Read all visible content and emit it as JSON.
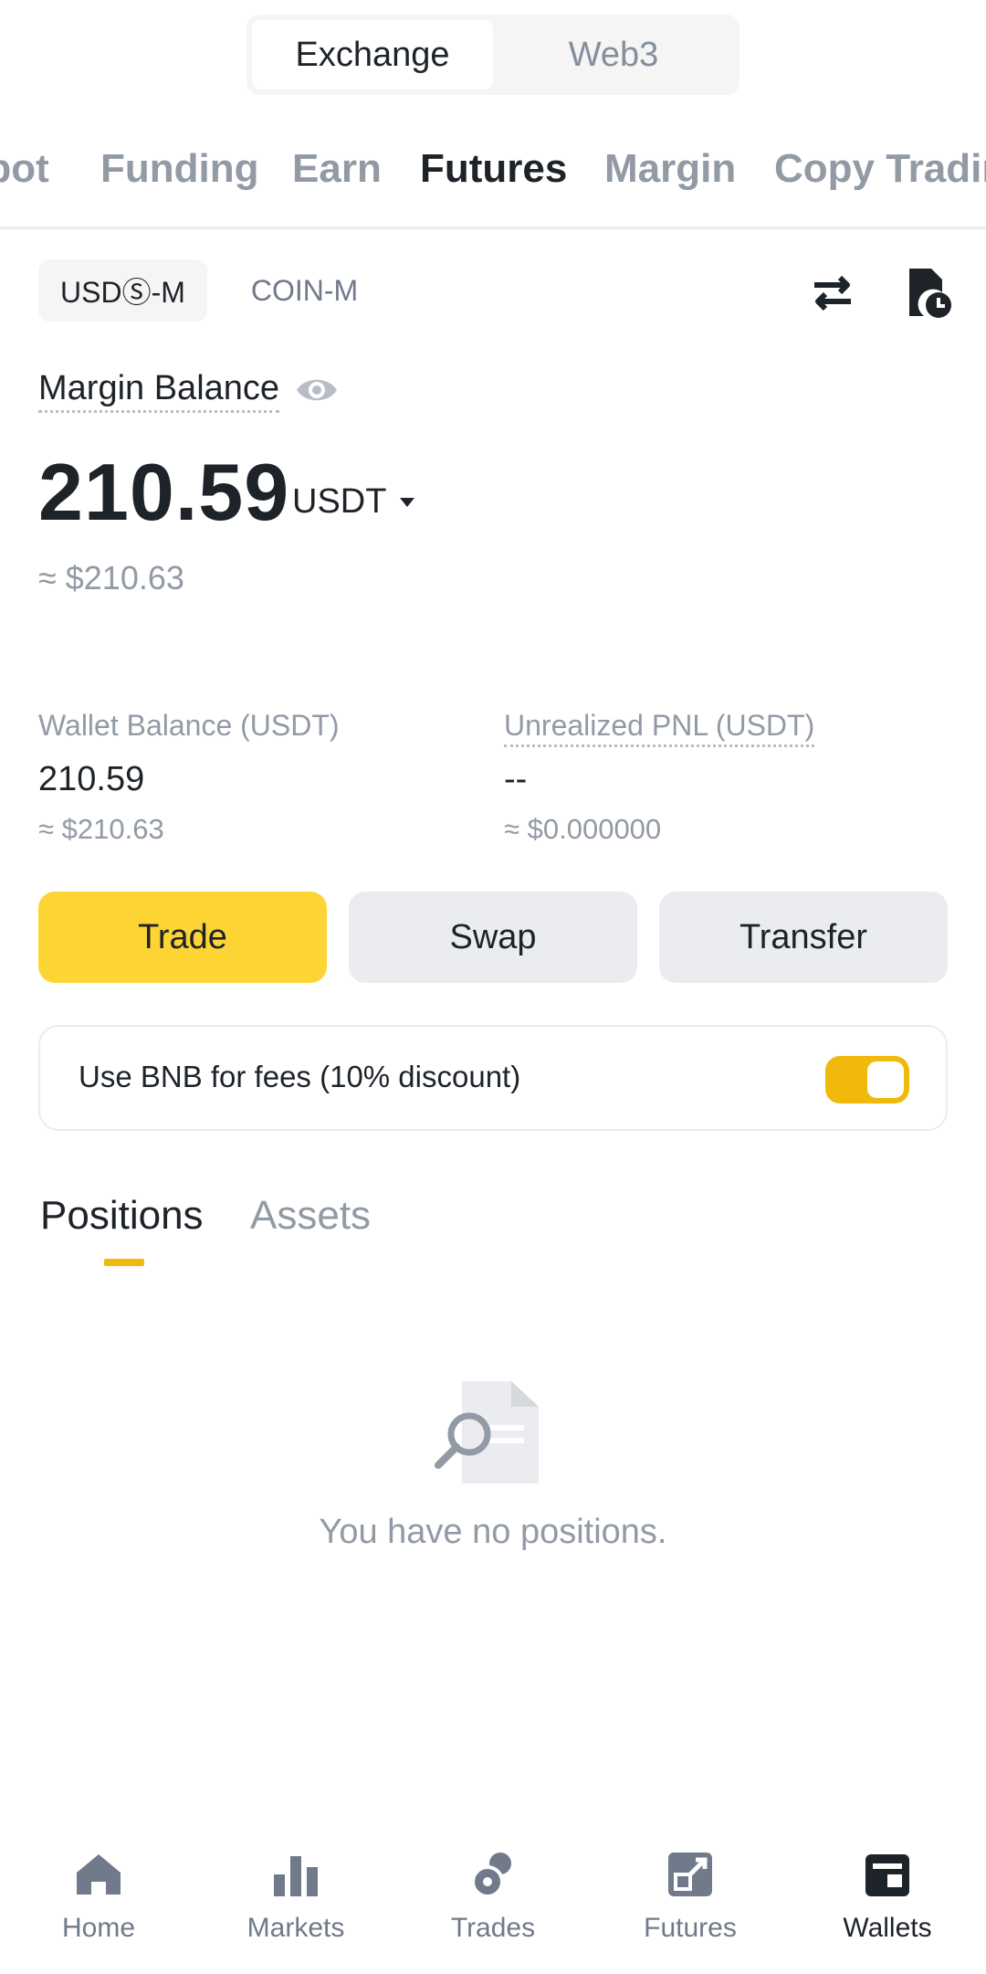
{
  "segment": {
    "options": [
      "Exchange",
      "Web3"
    ],
    "selected": "Exchange"
  },
  "top_tabs": [
    "Spot",
    "Funding",
    "Earn",
    "Futures",
    "Margin",
    "Copy Trading"
  ],
  "active_tab": "Futures",
  "sub_toggle": {
    "items": [
      "USDⓈ-M",
      "COIN-M"
    ],
    "selected": "USDⓈ-M"
  },
  "margin_balance": {
    "label": "Margin Balance",
    "value": "210.59",
    "unit": "USDT",
    "approx": "≈ $210.63"
  },
  "wallet_balance": {
    "label": "Wallet Balance (USDT)",
    "value": "210.59",
    "approx": "≈ $210.63"
  },
  "unrealized_pnl": {
    "label": "Unrealized PNL (USDT)",
    "value": "--",
    "approx": "≈ $0.000000"
  },
  "actions": {
    "trade": "Trade",
    "swap": "Swap",
    "transfer": "Transfer"
  },
  "bnb_fees": {
    "label": "Use BNB for fees (10% discount)",
    "enabled": true
  },
  "position_tabs": [
    "Positions",
    "Assets"
  ],
  "empty_message": "You have no positions.",
  "bottom_nav": [
    {
      "label": "Home",
      "icon": "home-icon"
    },
    {
      "label": "Markets",
      "icon": "bar-chart-icon"
    },
    {
      "label": "Trades",
      "icon": "trades-icon"
    },
    {
      "label": "Futures",
      "icon": "futures-icon"
    },
    {
      "label": "Wallets",
      "icon": "wallet-icon"
    }
  ],
  "colors": {
    "accent": "#fcd535",
    "toggle": "#f0b90b",
    "text": "#1e2329",
    "muted": "#929aa5"
  }
}
